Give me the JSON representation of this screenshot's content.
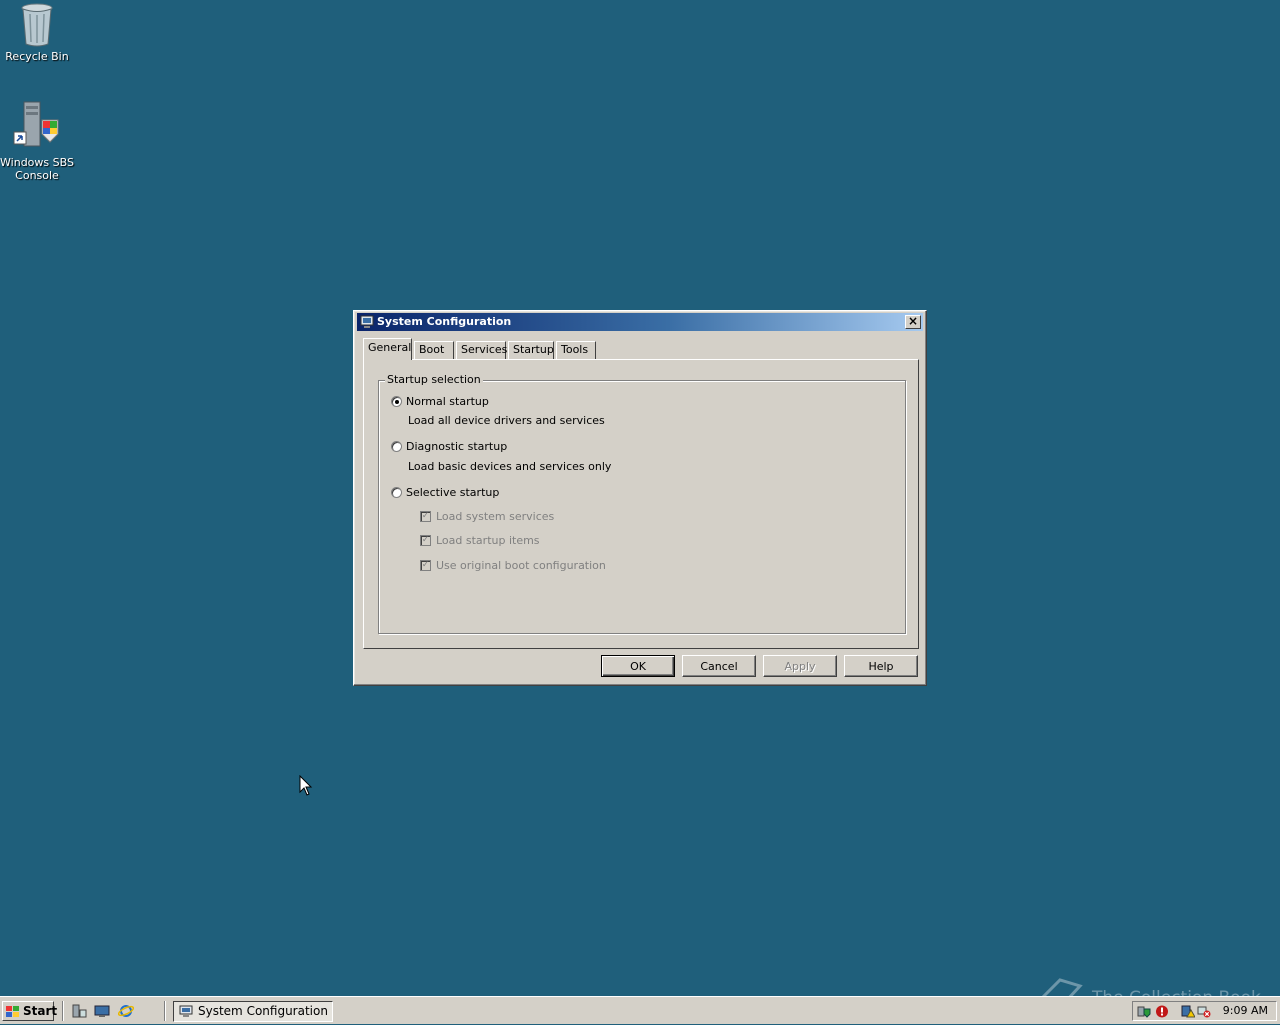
{
  "desktop": {
    "icons": [
      {
        "label": "Recycle Bin",
        "icon": "recycle-bin-icon"
      },
      {
        "label": "Windows SBS Console",
        "icon": "server-console-icon"
      }
    ]
  },
  "dialog": {
    "title": "System Configuration",
    "tabs": [
      "General",
      "Boot",
      "Services",
      "Startup",
      "Tools"
    ],
    "active_tab": "General",
    "group_label": "Startup selection",
    "options": [
      {
        "label": "Normal startup",
        "description": "Load all device drivers and services",
        "selected": true
      },
      {
        "label": "Diagnostic startup",
        "description": "Load basic devices and services only",
        "selected": false
      },
      {
        "label": "Selective startup",
        "selected": false
      }
    ],
    "selective_items": [
      {
        "label": "Load system services",
        "checked": true,
        "disabled": true
      },
      {
        "label": "Load startup items",
        "checked": true,
        "disabled": true
      },
      {
        "label": "Use original boot configuration",
        "checked": true,
        "disabled": true
      }
    ],
    "buttons": {
      "ok": "OK",
      "cancel": "Cancel",
      "apply": "Apply",
      "help": "Help"
    }
  },
  "taskbar": {
    "start_label": "Start",
    "task_label": "System Configuration",
    "clock": "9:09 AM"
  },
  "watermark": "The Collection Book",
  "colors": {
    "desktop": "#1f5f7b",
    "titlebar_start": "#0a246a",
    "titlebar_end": "#a6caf0",
    "face": "#d4d0c8"
  }
}
